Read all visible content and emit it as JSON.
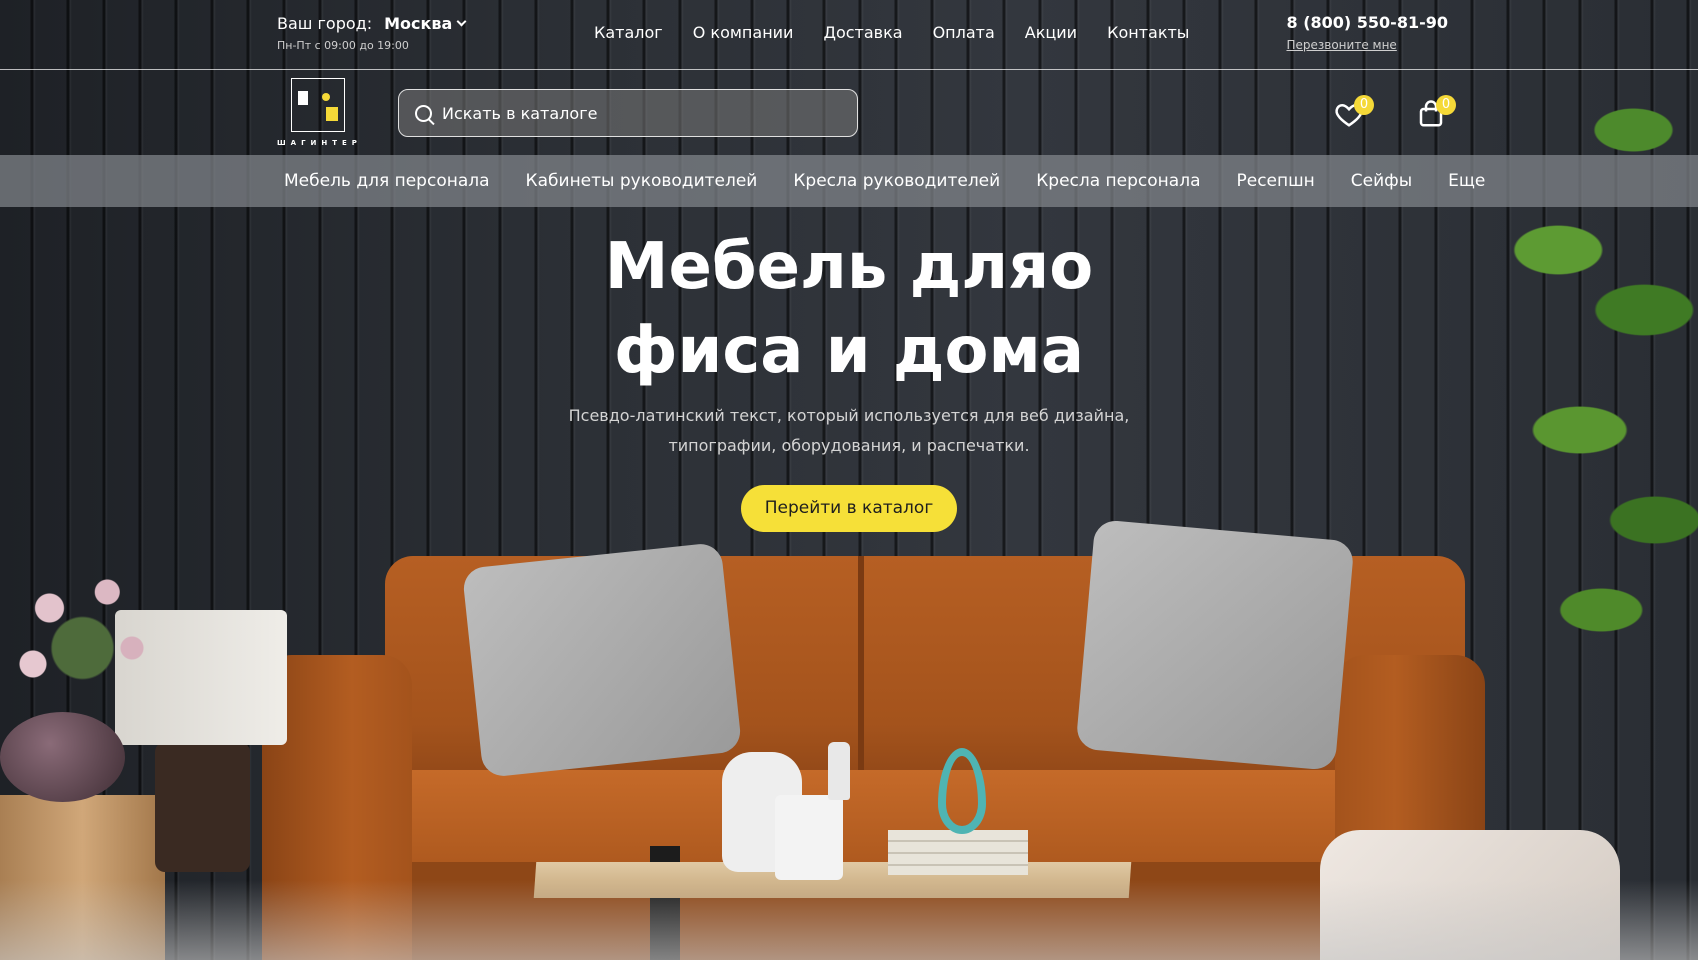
{
  "header": {
    "city_label": "Ваш город:",
    "city_value": "Москва",
    "hours": "Пн-Пт с 09:00 до 19:00",
    "nav": [
      "Каталог",
      "О компании",
      "Доставка",
      "Оплата",
      "Акции",
      "Контакты"
    ],
    "phone": "8 (800) 550-81-90",
    "callback": "Перезвоните мне"
  },
  "logo": {
    "text": "ШАГИНТЕР"
  },
  "search": {
    "placeholder": "Искать в каталоге",
    "icon": "search-icon"
  },
  "favorites": {
    "icon": "heart-icon",
    "count": "0"
  },
  "cart": {
    "icon": "bag-icon",
    "count": "0"
  },
  "categories": [
    "Мебель для персонала",
    "Кабинеты руководителей",
    "Кресла руководителей",
    "Кресла персонала",
    "Ресепшн",
    "Сейфы",
    "Еще"
  ],
  "hero": {
    "title_line1": "Мебель дляо",
    "title_line2": "фиса и дома",
    "subtitle_line1": "Псевдо-латинский текст, который используется для веб дизайна,",
    "subtitle_line2": "типографии, оборудования, и распечатки.",
    "cta": "Перейти в каталог"
  },
  "colors": {
    "accent": "#f6e038",
    "badge": "#f5d938"
  }
}
